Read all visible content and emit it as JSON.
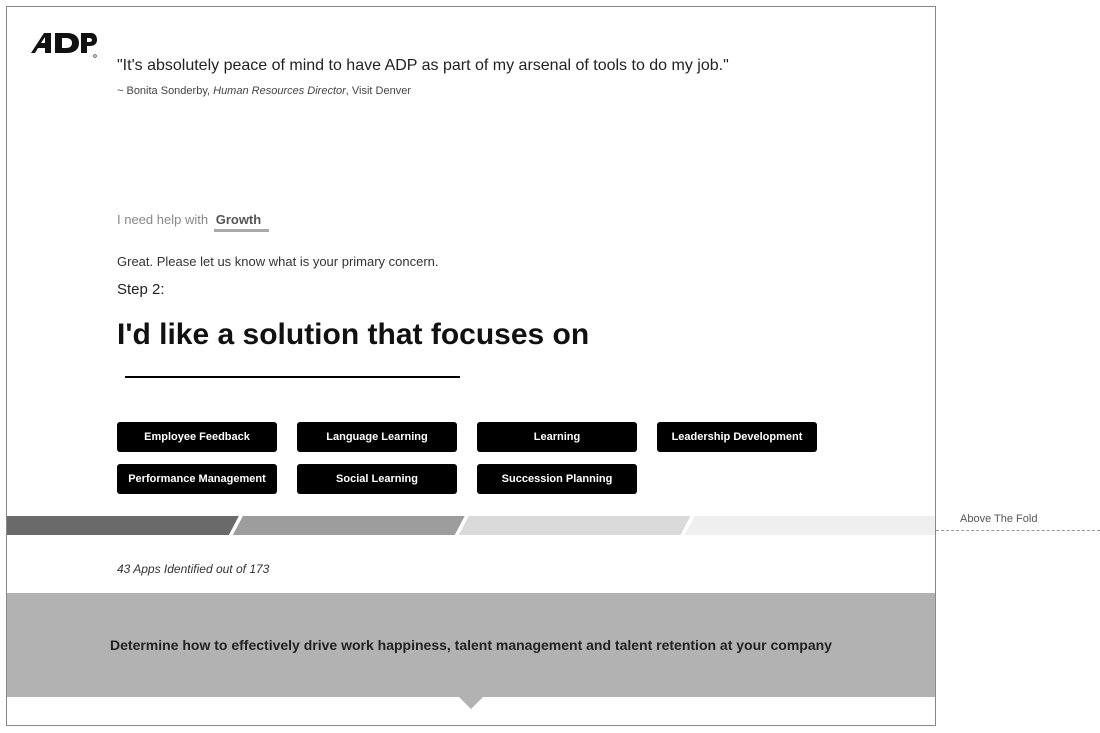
{
  "quote": "\"It's absolutely peace of mind to have ADP as part of my arsenal of tools to do my job.\"",
  "attribution": {
    "prefix": "~ Bonita Sonderby, ",
    "title": "Human Resources Director",
    "suffix": ", Visit Denver"
  },
  "help": {
    "label": "I need help with",
    "selection": "Growth"
  },
  "sub1": "Great. Please let us know what is your primary concern.",
  "stepLabel": "Step 2:",
  "headline": "I'd like a solution that focuses on",
  "options": [
    "Employee Feedback",
    "Language Learning",
    "Learning",
    "Leadership Development",
    "Performance Management",
    "Social Learning",
    "Succession Planning"
  ],
  "result": "43 Apps Identified out of 173",
  "foldLabel": "Above The Fold",
  "banner": "Determine how to effectively drive work happiness, talent management and talent retention at your company"
}
